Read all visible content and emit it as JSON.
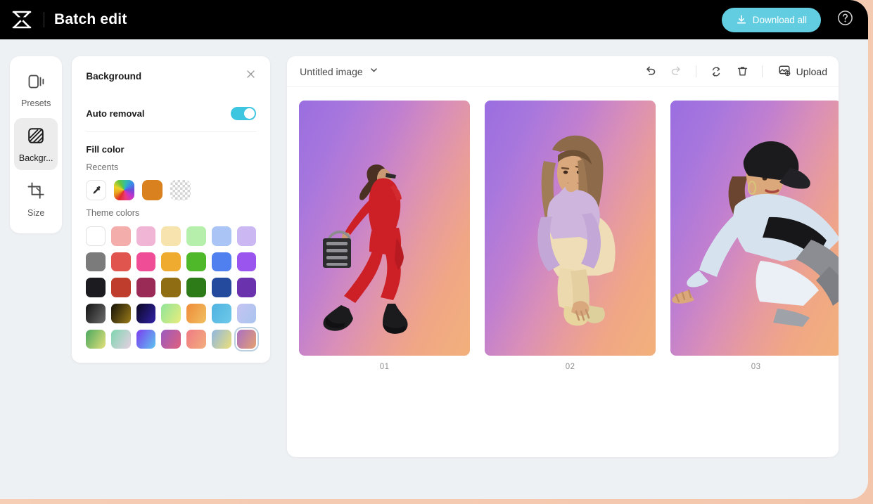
{
  "header": {
    "logo_icon": "capcut-logo-icon",
    "title": "Batch edit",
    "download_all_label": "Download all",
    "download_icon": "download-icon",
    "help_icon": "help-circle-icon",
    "accent_color": "#62cde0",
    "background_color": "#000000"
  },
  "sidebar": {
    "items": [
      {
        "label": "Presets",
        "icon": "presets-icon",
        "active": false
      },
      {
        "label": "Backgr...",
        "icon": "background-icon",
        "active": true
      },
      {
        "label": "Size",
        "icon": "crop-size-icon",
        "active": false
      }
    ]
  },
  "background_panel": {
    "title": "Background",
    "close_icon": "close-icon",
    "auto_removal_label": "Auto removal",
    "auto_removal_on": true,
    "toggle_color": "#3ec5e0",
    "fill_color_label": "Fill color",
    "recents_label": "Recents",
    "recents": [
      {
        "name": "eyedropper",
        "type": "eyedropper",
        "color": "#ffffff"
      },
      {
        "name": "color-wheel",
        "type": "wheel",
        "color": "#ff4fa3"
      },
      {
        "name": "orange",
        "type": "solid",
        "color": "#d9811f"
      },
      {
        "name": "transparent",
        "type": "checker",
        "color": "transparent"
      }
    ],
    "theme_colors_label": "Theme colors",
    "theme_rows": [
      [
        {
          "color": "#ffffff",
          "type": "solid",
          "selected": false
        },
        {
          "color": "#f3adaa",
          "type": "solid",
          "selected": false
        },
        {
          "color": "#f0b5d4",
          "type": "solid",
          "selected": false
        },
        {
          "color": "#f6e3ad",
          "type": "solid",
          "selected": false
        },
        {
          "color": "#b6eeab",
          "type": "solid",
          "selected": false
        },
        {
          "color": "#a9c4f5",
          "type": "solid",
          "selected": false
        },
        {
          "color": "#cbb8f3",
          "type": "solid",
          "selected": false
        }
      ],
      [
        {
          "color": "#7b7b7b",
          "type": "solid",
          "selected": false
        },
        {
          "color": "#e0564f",
          "type": "solid",
          "selected": false
        },
        {
          "color": "#ef4e96",
          "type": "solid",
          "selected": false
        },
        {
          "color": "#eeab2f",
          "type": "solid",
          "selected": false
        },
        {
          "color": "#4eb82a",
          "type": "solid",
          "selected": false
        },
        {
          "color": "#5080f0",
          "type": "solid",
          "selected": false
        },
        {
          "color": "#9a55ef",
          "type": "solid",
          "selected": false
        }
      ],
      [
        {
          "color": "#1b1b20",
          "type": "solid",
          "selected": false
        },
        {
          "color": "#bf3d2c",
          "type": "solid",
          "selected": false
        },
        {
          "color": "#992b56",
          "type": "solid",
          "selected": false
        },
        {
          "color": "#8f6d12",
          "type": "solid",
          "selected": false
        },
        {
          "color": "#2c7a18",
          "type": "solid",
          "selected": false
        },
        {
          "color": "#244a9e",
          "type": "solid",
          "selected": false
        },
        {
          "color": "#6a33ad",
          "type": "solid",
          "selected": false
        }
      ],
      [
        {
          "color": "#141414",
          "color2": "#6d6d6d",
          "type": "gradient",
          "selected": false
        },
        {
          "color": "#151208",
          "color2": "#9b7c18",
          "type": "gradient",
          "selected": false
        },
        {
          "color": "#0b0822",
          "color2": "#3122a8",
          "type": "gradient",
          "selected": false
        },
        {
          "color": "#8fe59a",
          "color2": "#e9ec7c",
          "type": "gradient",
          "selected": false
        },
        {
          "color": "#ef8b3a",
          "color2": "#f0c060",
          "type": "gradient",
          "selected": false
        },
        {
          "color": "#4fb3e0",
          "color2": "#6fc9ea",
          "type": "gradient",
          "selected": false
        },
        {
          "color": "#c6c4f2",
          "color2": "#a9c4ef",
          "type": "gradient",
          "selected": false
        }
      ],
      [
        {
          "color": "#4aa860",
          "color2": "#e3e07a",
          "type": "gradient",
          "selected": false
        },
        {
          "color": "#7fd6b0",
          "color2": "#e6cfe2",
          "type": "gradient",
          "selected": false
        },
        {
          "color": "#7a3df0",
          "color2": "#5ec4ef",
          "type": "gradient",
          "selected": false
        },
        {
          "color": "#9a5bc0",
          "color2": "#e0607c",
          "type": "gradient",
          "selected": false
        },
        {
          "color": "#f07a85",
          "color2": "#f2ae7c",
          "type": "gradient",
          "selected": false
        },
        {
          "color": "#8fb6e0",
          "color2": "#ece07a",
          "type": "gradient",
          "selected": false
        },
        {
          "color": "#a96fc4",
          "color2": "#e5a070",
          "type": "gradient",
          "selected": true
        }
      ]
    ]
  },
  "canvas": {
    "doc_name": "Untitled image",
    "doc_chevron_icon": "chevron-down-icon",
    "toolbar": [
      {
        "name": "undo-button",
        "icon": "undo-icon",
        "disabled": false
      },
      {
        "name": "redo-button",
        "icon": "redo-icon",
        "disabled": true
      },
      {
        "name": "replace-button",
        "icon": "swap-replace-icon",
        "disabled": false
      },
      {
        "name": "delete-button",
        "icon": "trash-icon",
        "disabled": false
      }
    ],
    "upload_label": "Upload",
    "upload_icon": "image-upload-icon",
    "images": [
      {
        "caption": "01",
        "alt": "woman walking in red jumpsuit holding a handbag"
      },
      {
        "caption": "02",
        "alt": "woman crouching in lilac fur jacket and cream trousers"
      },
      {
        "caption": "03",
        "alt": "woman leaning back wearing a black cap, white shirt and black top"
      }
    ],
    "gradient_start": "#9a6ee0",
    "gradient_end": "#f2b07b"
  }
}
